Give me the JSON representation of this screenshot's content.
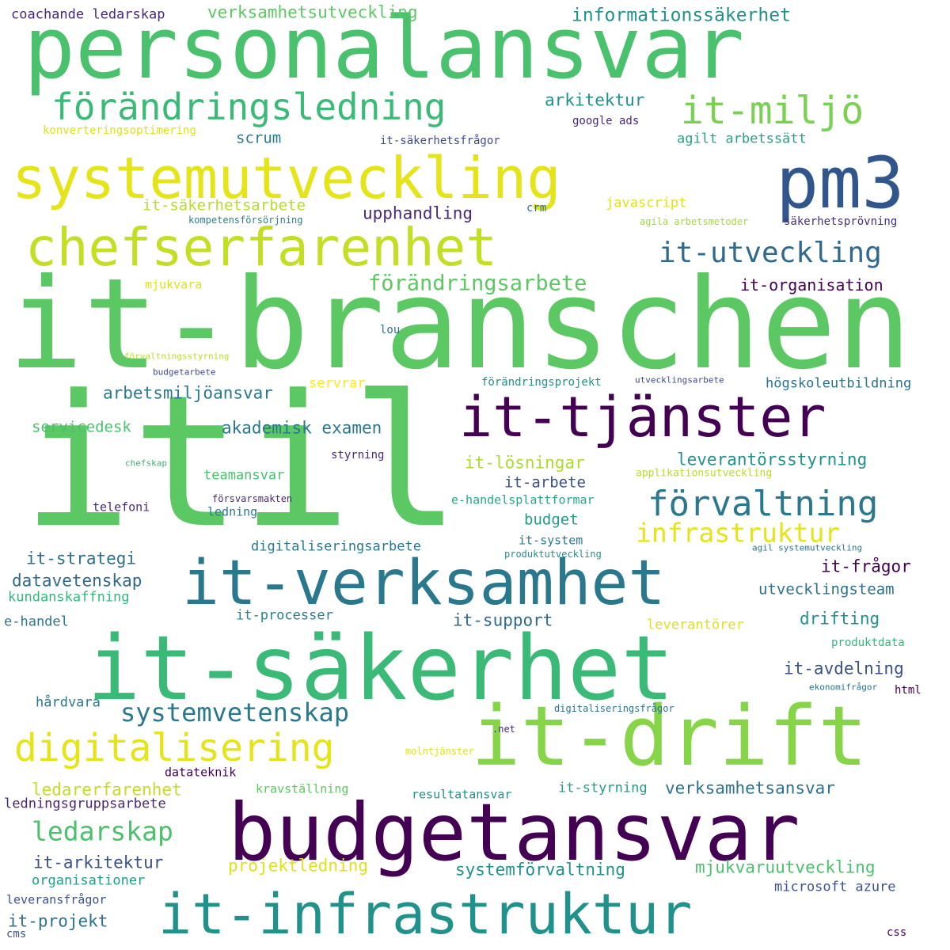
{
  "words": [
    {
      "text": "itil",
      "color": "#5cc863"
    },
    {
      "text": "it-branschen",
      "color": "#5cc863"
    },
    {
      "text": "personalansvar",
      "color": "#4ac16d"
    },
    {
      "text": "budgetansvar",
      "color": "#440154"
    },
    {
      "text": "it-säkerhet",
      "color": "#3aba76"
    },
    {
      "text": "systemutveckling",
      "color": "#e5e419"
    },
    {
      "text": "pm3",
      "color": "#31568c"
    },
    {
      "text": "it-drift",
      "color": "#86d549"
    },
    {
      "text": "chefserfarenhet",
      "color": "#c2df23"
    },
    {
      "text": "it-verksamhet",
      "color": "#2a788e"
    },
    {
      "text": "it-infrastruktur",
      "color": "#21918c"
    },
    {
      "text": "it-tjänster",
      "color": "#440154"
    },
    {
      "text": "förändringsledning",
      "color": "#3aba76"
    },
    {
      "text": "it-miljö",
      "color": "#7ad151"
    },
    {
      "text": "digitalisering",
      "color": "#e5e419"
    },
    {
      "text": "förvaltning",
      "color": "#2a788e"
    },
    {
      "text": "it-utveckling",
      "color": "#31688e"
    },
    {
      "text": "infrastruktur",
      "color": "#e5e419"
    },
    {
      "text": "systemvetenskap",
      "color": "#2a788e"
    },
    {
      "text": "ledarskap",
      "color": "#4ac16d"
    },
    {
      "text": "förändringsarbete",
      "color": "#5cc863"
    },
    {
      "text": "verksamhetsutveckling",
      "color": "#5cc863"
    },
    {
      "text": "informationssäkerhet",
      "color": "#21918c"
    },
    {
      "text": "coachande ledarskap",
      "color": "#482878"
    },
    {
      "text": "arkitektur",
      "color": "#21918c"
    },
    {
      "text": "konverteringsoptimering",
      "color": "#dde318"
    },
    {
      "text": "scrum",
      "color": "#2a788e"
    },
    {
      "text": "google ads",
      "color": "#482878"
    },
    {
      "text": "agilt arbetssätt",
      "color": "#21a585"
    },
    {
      "text": "it-säkerhetsfrågor",
      "color": "#3e4989"
    },
    {
      "text": "it-säkerhetsarbete",
      "color": "#b5de2b"
    },
    {
      "text": "javascript",
      "color": "#dde318"
    },
    {
      "text": "upphandling",
      "color": "#482878"
    },
    {
      "text": "crm",
      "color": "#2c728e"
    },
    {
      "text": "kompetensförsörjning",
      "color": "#26828e"
    },
    {
      "text": "agila arbetsmetoder",
      "color": "#a5db36"
    },
    {
      "text": "säkerhetsprövning",
      "color": "#472f7d"
    },
    {
      "text": "it-organisation",
      "color": "#440154"
    },
    {
      "text": "mjukvara",
      "color": "#dde318"
    },
    {
      "text": "lou",
      "color": "#2c728e"
    },
    {
      "text": "förvaltningsstyrning",
      "color": "#b5de2b"
    },
    {
      "text": "budgetarbete",
      "color": "#3e4989"
    },
    {
      "text": "förändringsprojekt",
      "color": "#21918c"
    },
    {
      "text": "utvecklingsarbete",
      "color": "#3e4989"
    },
    {
      "text": "högskoleutbildning",
      "color": "#2c728e"
    },
    {
      "text": "arbetsmiljöansvar",
      "color": "#2a788e"
    },
    {
      "text": "servrar",
      "color": "#fde725"
    },
    {
      "text": "servicedesk",
      "color": "#4ac16d"
    },
    {
      "text": "akademisk examen",
      "color": "#2a788e"
    },
    {
      "text": "styrning",
      "color": "#482878"
    },
    {
      "text": "chefskap",
      "color": "#35b779"
    },
    {
      "text": "teamansvar",
      "color": "#4ac16d"
    },
    {
      "text": "it-lösningar",
      "color": "#addc30"
    },
    {
      "text": "leverantörsstyrning",
      "color": "#21918c"
    },
    {
      "text": "it-arbete",
      "color": "#3b528b"
    },
    {
      "text": "applikationsutveckling",
      "color": "#b5de2b"
    },
    {
      "text": "e-handelsplattformar",
      "color": "#22a884"
    },
    {
      "text": "telefoni",
      "color": "#482878"
    },
    {
      "text": "försvarsmakten",
      "color": "#482878"
    },
    {
      "text": "ledning",
      "color": "#2a788e"
    },
    {
      "text": "budget",
      "color": "#1f9e89"
    },
    {
      "text": "it-system",
      "color": "#2a788e"
    },
    {
      "text": "it-strategi",
      "color": "#2c728e"
    },
    {
      "text": "digitaliseringsarbete",
      "color": "#2a788e"
    },
    {
      "text": "produktutveckling",
      "color": "#21918c"
    },
    {
      "text": "agil systemutveckling",
      "color": "#2c728e"
    },
    {
      "text": "it-frågor",
      "color": "#440154"
    },
    {
      "text": "datavetenskap",
      "color": "#31688e"
    },
    {
      "text": "kundanskaffning",
      "color": "#35b779"
    },
    {
      "text": "utvecklingsteam",
      "color": "#2c728e"
    },
    {
      "text": "e-handel",
      "color": "#2a788e"
    },
    {
      "text": "it-processer",
      "color": "#26828e"
    },
    {
      "text": "it-support",
      "color": "#31688e"
    },
    {
      "text": "drifting",
      "color": "#21918c"
    },
    {
      "text": "leverantörer",
      "color": "#dde318"
    },
    {
      "text": "produktdata",
      "color": "#35b779"
    },
    {
      "text": "it-avdelning",
      "color": "#3b528b"
    },
    {
      "text": "ekonomifrågor",
      "color": "#2c728e"
    },
    {
      "text": "html",
      "color": "#440154"
    },
    {
      "text": "hårdvara",
      "color": "#2a788e"
    },
    {
      "text": "digitaliseringsfrågor",
      "color": "#2c728e"
    },
    {
      "text": ".net",
      "color": "#482878"
    },
    {
      "text": "molntjänster",
      "color": "#dde318"
    },
    {
      "text": "datateknik",
      "color": "#440154"
    },
    {
      "text": "kravställning",
      "color": "#5cc863"
    },
    {
      "text": "ledarerfarenhet",
      "color": "#c2df23"
    },
    {
      "text": "it-styrning",
      "color": "#1f9e89"
    },
    {
      "text": "resultatansvar",
      "color": "#21918c"
    },
    {
      "text": "verksamhetsansvar",
      "color": "#2c728e"
    },
    {
      "text": "ledningsgruppsarbete",
      "color": "#482878"
    },
    {
      "text": "it-arkitektur",
      "color": "#3b528b"
    },
    {
      "text": "projektledning",
      "color": "#dde318"
    },
    {
      "text": "systemförvaltning",
      "color": "#21918c"
    },
    {
      "text": "mjukvaruutveckling",
      "color": "#4ac16d"
    },
    {
      "text": "organisationer",
      "color": "#1f9e89"
    },
    {
      "text": "microsoft azure",
      "color": "#3b528b"
    },
    {
      "text": "leveransfrågor",
      "color": "#3b528b"
    },
    {
      "text": "it-projekt",
      "color": "#2c728e"
    },
    {
      "text": "cms",
      "color": "#3b528b"
    },
    {
      "text": "css",
      "color": "#440154"
    }
  ]
}
